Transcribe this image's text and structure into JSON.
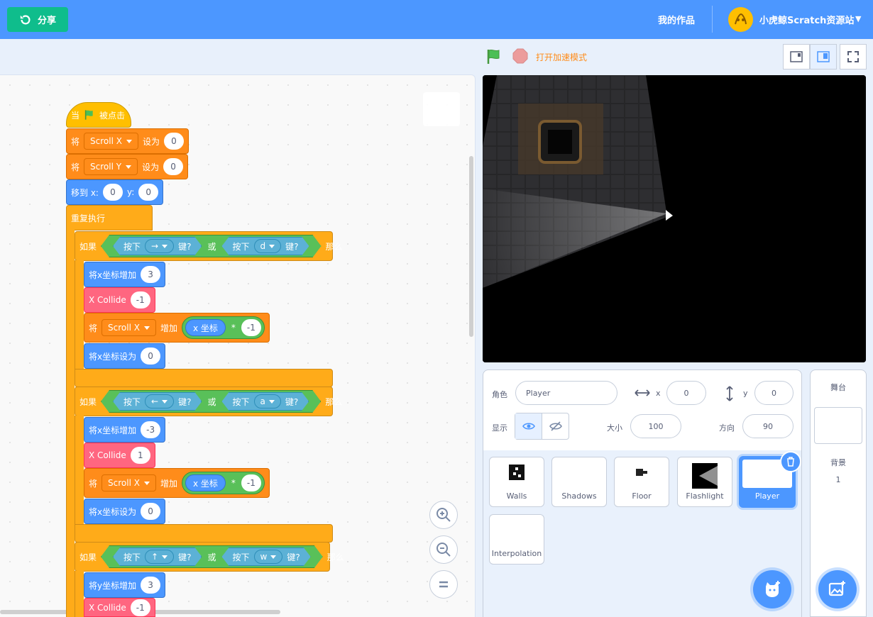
{
  "topbar": {
    "share_label": "分享",
    "my_works": "我的作品",
    "user_name": "小虎鲸Scratch资源站"
  },
  "stage_controls": {
    "turbo_label": "打开加速模式"
  },
  "code": {
    "when_flag": [
      "当",
      "被点击"
    ],
    "set_label": "将",
    "set_to": "设为",
    "scroll_x": "Scroll X",
    "scroll_y": "Scroll Y",
    "zero": "0",
    "goto_label": "移到 x:",
    "goto_y": "y:",
    "forever": "重复执行",
    "if": "如果",
    "then": "那么",
    "or": "或",
    "key_pressed": "按下",
    "key_q": "键?",
    "change": "增加",
    "x_pos": "x 坐标",
    "times": "*",
    "neg1": "-1",
    "pos1": "1",
    "collide": "X Collide",
    "key_right": "→",
    "key_left": "←",
    "key_up": "↑",
    "key_d": "d",
    "key_a": "a",
    "key_w": "w",
    "change_x": "将x坐标增加",
    "set_x": "将x坐标设为",
    "change_y": "将y坐标增加",
    "three": "3",
    "neg3": "-3"
  },
  "sprite_info": {
    "sprite_label": "角色",
    "sprite_name": "Player",
    "x_label": "x",
    "x_value": "0",
    "y_label": "y",
    "y_value": "0",
    "show_label": "显示",
    "size_label": "大小",
    "size_value": "100",
    "direction_label": "方向",
    "direction_value": "90"
  },
  "sprites": [
    {
      "name": "Walls"
    },
    {
      "name": "Shadows"
    },
    {
      "name": "Floor"
    },
    {
      "name": "Flashlight"
    },
    {
      "name": "Player",
      "selected": true
    },
    {
      "name": "Interpolation"
    }
  ],
  "stage_pane": {
    "title": "舞台",
    "backdrop_label": "背景",
    "backdrop_count": "1"
  },
  "colors": {
    "top_bar": "#4c97ff",
    "share": "#0fbd8c",
    "events": "#ffbf00",
    "variables": "#ff8c1a",
    "motion": "#4c97ff",
    "control": "#ffab19",
    "operators": "#59c059",
    "sensing": "#5cb1d6",
    "custom": "#ff6680"
  }
}
